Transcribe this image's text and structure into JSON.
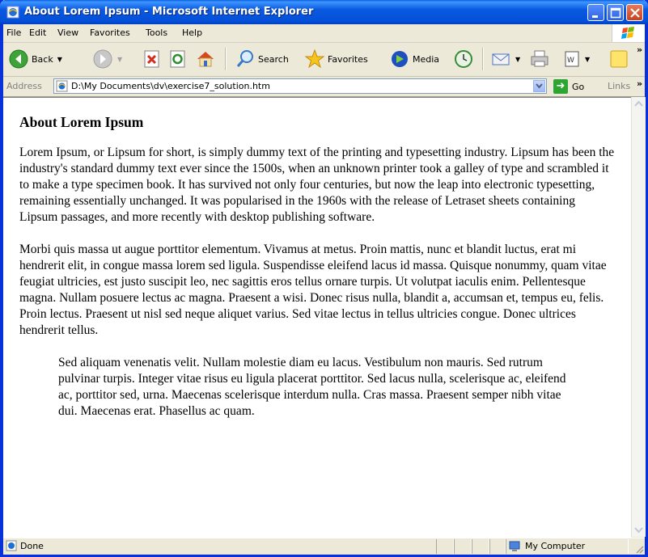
{
  "window": {
    "title": "About Lorem Ipsum - Microsoft Internet Explorer"
  },
  "menu": {
    "items": [
      "File",
      "Edit",
      "View",
      "Favorites",
      "Tools",
      "Help"
    ]
  },
  "toolbar": {
    "back_label": "Back",
    "search_label": "Search",
    "favorites_label": "Favorites",
    "media_label": "Media",
    "overflow": "»"
  },
  "address": {
    "label": "Address",
    "value": "D:\\My Documents\\dv\\exercise7_solution.htm",
    "go_label": "Go",
    "links_label": "Links",
    "overflow": "»"
  },
  "page": {
    "heading": "About Lorem Ipsum",
    "paragraph1": "Lorem Ipsum, or Lipsum for short, is simply dummy text of the printing and typesetting industry. Lipsum has been the industry's standard dummy text ever since the 1500s, when an unknown printer took a galley of type and scrambled it to make a type specimen book. It has survived not only four centuries, but now the leap into electronic typesetting, remaining essentially unchanged. It was popularised in the 1960s with the release of Letraset sheets containing Lipsum passages, and more recently with desktop publishing software.",
    "paragraph2": "Morbi quis massa ut augue porttitor elementum. Vivamus at metus. Proin mattis, nunc et blandit luctus, erat mi hendrerit elit, in congue massa lorem sed ligula. Suspendisse eleifend lacus id massa. Quisque nonummy, quam vitae feugiat ultricies, est justo suscipit leo, nec sagittis eros tellus ornare turpis. Ut volutpat iaculis enim. Pellentesque magna. Nullam posuere lectus ac magna. Praesent a wisi. Donec risus nulla, blandit a, accumsan et, tempus eu, felis. Proin lectus. Praesent ut nisl sed neque aliquet varius. Sed vitae lectus in tellus ultricies congue. Donec ultrices hendrerit tellus.",
    "blockquote": "Sed aliquam venenatis velit. Nullam molestie diam eu lacus. Vestibulum non mauris. Sed rutrum pulvinar turpis. Integer vitae risus eu ligula placerat porttitor. Sed lacus nulla, scelerisque ac, eleifend ac, porttitor sed, urna. Maecenas scelerisque interdum nulla. Cras massa. Praesent semper nibh vitae dui. Maecenas erat. Phasellus ac quam."
  },
  "status": {
    "text": "Done",
    "zone": "My Computer"
  },
  "colors": {
    "titlebar": "#0a5fe0",
    "chrome": "#ece9d8",
    "frame": "#0831d9"
  }
}
